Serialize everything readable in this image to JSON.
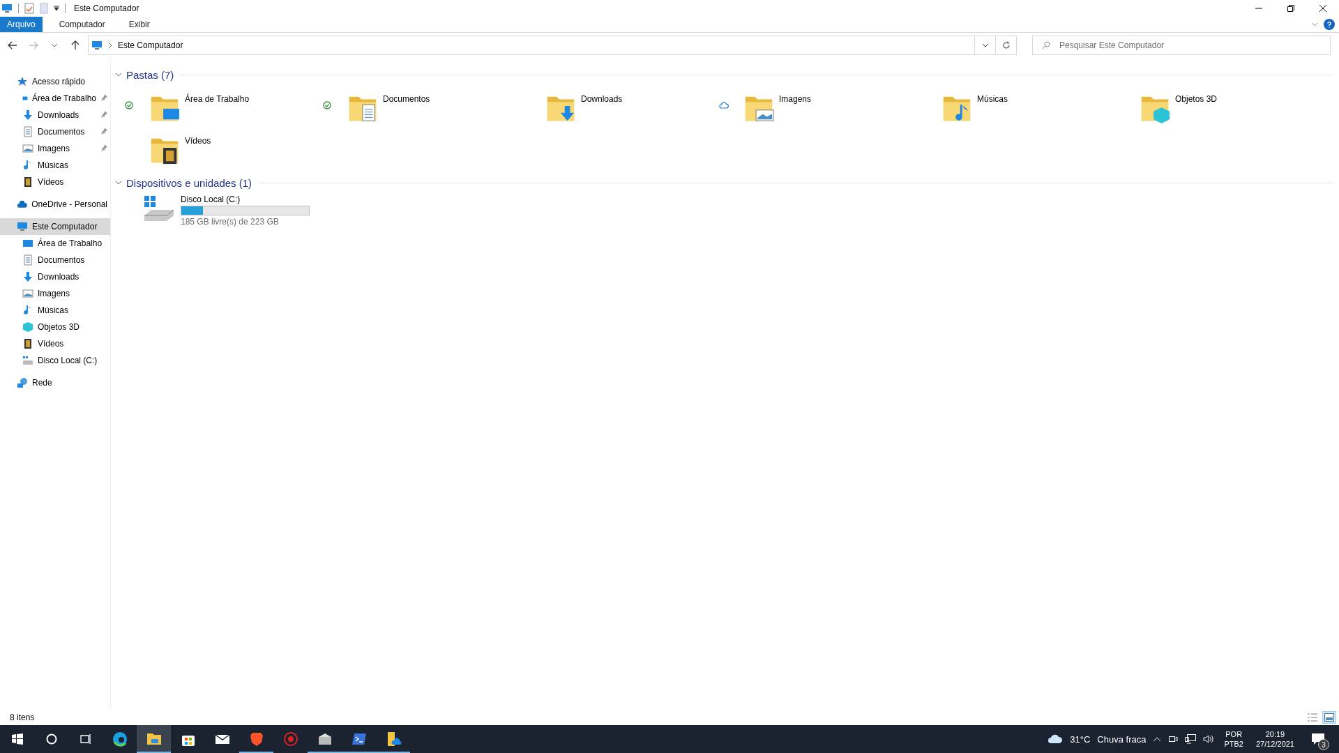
{
  "window": {
    "title": "Este Computador"
  },
  "ribbon_tabs": [
    {
      "label": "Arquivo",
      "selected": true
    },
    {
      "label": "Computador",
      "selected": false
    },
    {
      "label": "Exibir",
      "selected": false
    }
  ],
  "address": {
    "path": "Este Computador"
  },
  "search": {
    "placeholder": "Pesquisar Este Computador"
  },
  "sidebar": {
    "items": [
      {
        "label": "Acesso rápido",
        "kind": "star",
        "selected": false,
        "children": [
          {
            "label": "Área de Trabalho",
            "kind": "desktop",
            "pinned": true,
            "selected": false
          },
          {
            "label": "Downloads",
            "kind": "downloads",
            "pinned": true,
            "selected": false
          },
          {
            "label": "Documentos",
            "kind": "documents",
            "pinned": true,
            "selected": false
          },
          {
            "label": "Imagens",
            "kind": "pictures",
            "pinned": true,
            "selected": false
          },
          {
            "label": "Músicas",
            "kind": "music",
            "pinned": false,
            "selected": false
          },
          {
            "label": "Vídeos",
            "kind": "videos",
            "pinned": false,
            "selected": false
          }
        ]
      },
      {
        "label": "OneDrive - Personal",
        "kind": "cloud",
        "selected": false
      },
      {
        "label": "Este Computador",
        "kind": "computer",
        "selected": true,
        "children": [
          {
            "label": "Área de Trabalho",
            "kind": "desktop",
            "selected": false
          },
          {
            "label": "Documentos",
            "kind": "documents",
            "selected": false
          },
          {
            "label": "Downloads",
            "kind": "downloads",
            "selected": false
          },
          {
            "label": "Imagens",
            "kind": "pictures",
            "selected": false
          },
          {
            "label": "Músicas",
            "kind": "music",
            "selected": false
          },
          {
            "label": "Objetos 3D",
            "kind": "objects",
            "selected": false
          },
          {
            "label": "Vídeos",
            "kind": "videos",
            "selected": false
          },
          {
            "label": "Disco Local (C:)",
            "kind": "drive",
            "selected": false
          }
        ]
      },
      {
        "label": "Rede",
        "kind": "network",
        "selected": false
      }
    ]
  },
  "folders": {
    "title": "Pastas (7)",
    "expanded": true,
    "items": [
      {
        "label": "Área de Trabalho",
        "kind": "desktop",
        "synced": true,
        "online_only": false
      },
      {
        "label": "Documentos",
        "kind": "documents",
        "synced": true,
        "online_only": false
      },
      {
        "label": "Downloads",
        "kind": "downloads",
        "synced": false,
        "online_only": false
      },
      {
        "label": "Imagens",
        "kind": "pictures",
        "synced": false,
        "online_only": true
      },
      {
        "label": "Músicas",
        "kind": "music",
        "synced": false,
        "online_only": false
      },
      {
        "label": "Objetos 3D",
        "kind": "objects",
        "synced": false,
        "online_only": false
      },
      {
        "label": "Vídeos",
        "kind": "videos",
        "synced": false,
        "online_only": false
      }
    ]
  },
  "devices": {
    "title": "Dispositivos e unidades (1)",
    "expanded": true,
    "items": [
      {
        "label": "Disco Local (C:)",
        "level": 0.17,
        "free": "185 GB livre(s) de 223 GB"
      }
    ]
  },
  "status_bar": {
    "count": "8 itens",
    "views": [
      {
        "kind": "details",
        "selected": false
      },
      {
        "kind": "tiles",
        "selected": true
      }
    ]
  },
  "taskbar": {
    "apps": [
      {
        "kind": "edge",
        "running": false,
        "selected": false
      },
      {
        "kind": "explorer",
        "running": true,
        "selected": true
      },
      {
        "kind": "store",
        "running": false,
        "selected": false
      },
      {
        "kind": "mail",
        "running": false,
        "selected": false
      },
      {
        "kind": "brave",
        "running": true,
        "selected": false
      },
      {
        "kind": "tool",
        "running": false,
        "selected": false
      },
      {
        "kind": "installer",
        "running": true,
        "selected": false
      },
      {
        "kind": "terminal",
        "running": true,
        "selected": false
      },
      {
        "kind": "onedrive-folder",
        "running": true,
        "selected": false
      }
    ],
    "weather": {
      "temp": "31°C",
      "desc": "Chuva fraca"
    },
    "language": {
      "lang": "POR",
      "layout": "PTB2"
    },
    "clock": {
      "time": "20:19",
      "date": "27/12/2021"
    },
    "notifications": "3"
  }
}
